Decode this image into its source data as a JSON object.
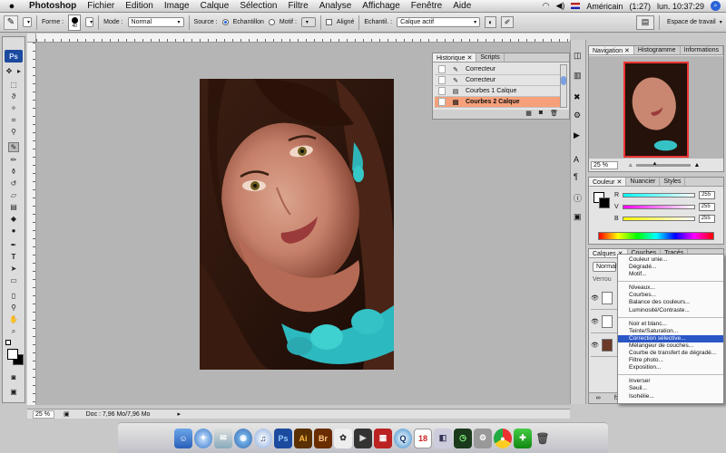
{
  "menubar": {
    "apple_icon": "apple-icon",
    "app_name": "Photoshop",
    "items": [
      "Fichier",
      "Edition",
      "Image",
      "Calque",
      "Sélection",
      "Filtre",
      "Analyse",
      "Affichage",
      "Fenêtre",
      "Aide"
    ],
    "input_source": "Américain",
    "battery": "(1:27)",
    "clock": "lun. 10:37:29"
  },
  "options": {
    "forme_label": "Forme :",
    "brush_size": "40",
    "mode_label": "Mode :",
    "mode_value": "Normal",
    "source_label": "Source :",
    "echantillon_label": "Echantillon",
    "motif_label": "Motif :",
    "aligne_label": "Aligné",
    "echantil_label": "Echantil. :",
    "echantil_value": "Calque actif",
    "workspace_label": "Espace de travail"
  },
  "history": {
    "tabs": [
      "Historique",
      "Scripts"
    ],
    "rows": [
      "Correcteur",
      "Correcteur",
      "Courbes 1 Calque",
      "Courbes 2 Calque"
    ],
    "selected_index": 3
  },
  "navigator": {
    "tabs": [
      "Navigation",
      "Histogramme",
      "Informations"
    ],
    "zoom": "25 %"
  },
  "color": {
    "tabs": [
      "Couleur",
      "Nuancier",
      "Styles"
    ],
    "channels": [
      {
        "label": "R",
        "value": "255"
      },
      {
        "label": "V",
        "value": "255"
      },
      {
        "label": "B",
        "value": "255"
      }
    ]
  },
  "layers": {
    "tabs": [
      "Calques",
      "Couches",
      "Tracés"
    ],
    "blend_mode": "Normal",
    "lock_label": "Verrou"
  },
  "adjust_menu": {
    "groups": [
      [
        "Couleur unie...",
        "Dégradé...",
        "Motif..."
      ],
      [
        "Niveaux...",
        "Courbes...",
        "Balance des couleurs...",
        "Luminosité/Contraste..."
      ],
      [
        "Noir et blanc...",
        "Teinte/Saturation...",
        "Correction sélective...",
        "Mélangeur de couches...",
        "Courbe de transfert de dégradé...",
        "Filtre photo...",
        "Exposition..."
      ],
      [
        "Inverser",
        "Seuil...",
        "Isohélie..."
      ]
    ],
    "highlighted": "Correction sélective..."
  },
  "status": {
    "zoom": "25 %",
    "doc": "Doc : 7,96 Mo/7,96 Mo"
  },
  "colors": {
    "accent_selection": "#f5a07a",
    "menu_highlight": "#2a56c6",
    "ps_blue": "#1c4a9e"
  },
  "dock": {
    "icons": [
      "finder-icon",
      "safari-icon",
      "mail-icon",
      "ichat-icon",
      "itunes-icon",
      "photoshop-icon",
      "illustrator-icon",
      "bridge-icon",
      "dictionary-icon",
      "frontrow-icon",
      "iphoto-icon",
      "quicktime-icon",
      "ical-icon",
      "preview-icon",
      "timemachine-icon",
      "syspref-icon",
      "chrome-icon",
      "trash-icon"
    ],
    "labels": {
      "ps": "Ps",
      "ai": "Ai",
      "br": "Br"
    }
  }
}
